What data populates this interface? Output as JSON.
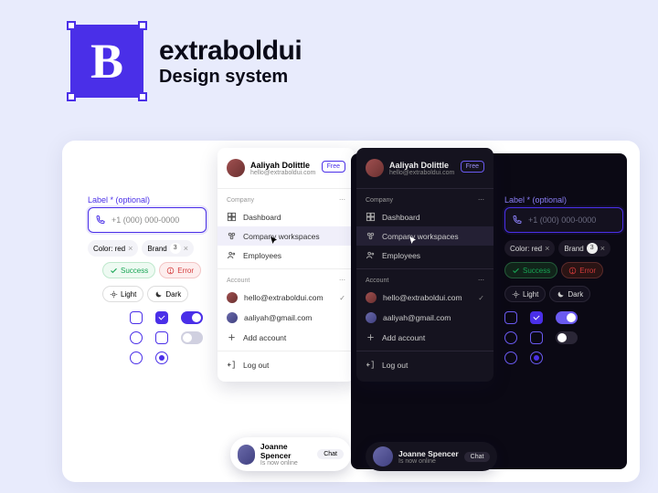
{
  "brand": {
    "logo_letter": "B",
    "name": "extraboldui",
    "tagline": "Design system"
  },
  "input": {
    "label": "Label * (optional)",
    "placeholder": "+1 (000) 000-0000"
  },
  "tags": [
    {
      "label": "Color: red"
    },
    {
      "label": "Brand",
      "count": "3"
    }
  ],
  "statuses": {
    "success": "Success",
    "error": "Error"
  },
  "theme": {
    "light": "Light",
    "dark": "Dark"
  },
  "sidebar": {
    "user": {
      "name": "Aaliyah Dolittle",
      "email": "hello@extraboldui.com",
      "plan": "Free"
    },
    "sections": {
      "company": {
        "header": "Company",
        "items": [
          {
            "label": "Dashboard",
            "icon": "dashboard-icon"
          },
          {
            "label": "Company workspaces",
            "icon": "workspaces-icon",
            "active": true
          },
          {
            "label": "Employees",
            "icon": "employees-icon"
          }
        ]
      },
      "account": {
        "header": "Account",
        "items": [
          {
            "label": "hello@extraboldui.com",
            "icon": "avatar",
            "checked": true
          },
          {
            "label": "aaliyah@gmail.com",
            "icon": "avatar"
          },
          {
            "label": "Add account",
            "icon": "plus-icon"
          }
        ]
      }
    },
    "logout": "Log out"
  },
  "toast": {
    "name": "Joanne Spencer",
    "status": "Is now online",
    "action": "Chat"
  },
  "colors": {
    "accent": "#4a2fe8",
    "success": "#17a554",
    "error": "#d43a3a",
    "dark_bg": "#0b0914"
  }
}
